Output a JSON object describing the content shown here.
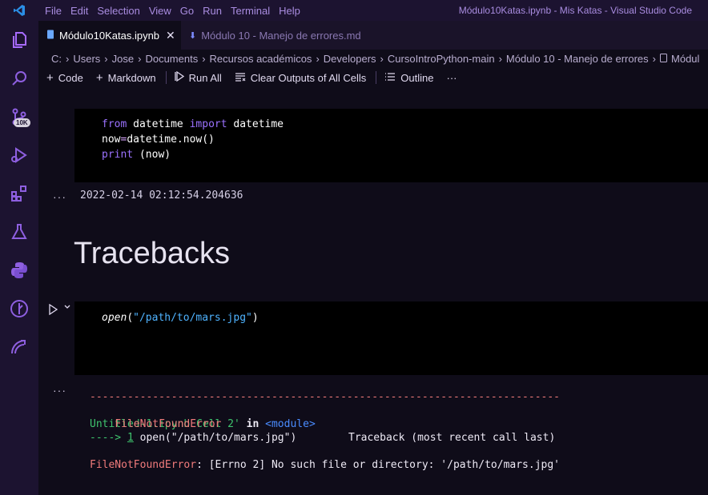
{
  "titlebar": {
    "menu": [
      "File",
      "Edit",
      "Selection",
      "View",
      "Go",
      "Run",
      "Terminal",
      "Help"
    ],
    "window_title": "Módulo10Katas.ipynb - Mis Katas - Visual Studio Code"
  },
  "activity_bar": {
    "badge": "10K"
  },
  "tabs": [
    {
      "label": "Módulo10Katas.ipynb",
      "active": true
    },
    {
      "label": "Módulo 10 - Manejo de errores.md",
      "active": false
    }
  ],
  "breadcrumb": [
    "C:",
    "Users",
    "Jose",
    "Documents",
    "Recursos académicos",
    "Developers",
    "CursoIntroPython-main",
    "Módulo 10 - Manejo de errores",
    "Módul"
  ],
  "toolbar": {
    "code": "Code",
    "markdown": "Markdown",
    "run_all": "Run All",
    "clear": "Clear Outputs of All Cells",
    "outline": "Outline",
    "more": "···"
  },
  "cell1": {
    "line1": {
      "kw1": "from",
      "mod": " datetime ",
      "kw2": "import",
      "name": " datetime"
    },
    "line2": {
      "a": "now",
      "eq": "=",
      "b": "datetime.now()"
    },
    "line3": {
      "kw": "print",
      "rest": " (now)"
    },
    "output": "2022-02-14 02:12:54.204636"
  },
  "heading": "Tracebacks",
  "cell2": {
    "fn": "open",
    "open_paren": "(",
    "arg": "\"/path/to/mars.jpg\"",
    "close_paren": ")"
  },
  "traceback": {
    "dashes": "---------------------------------------------------------------------------",
    "error_name": "FileNotFoundError",
    "header_right": "Traceback (most recent call last)",
    "cell_ref": "Untitled-1.ipynb Cell 2'",
    "in": " in ",
    "module": "<module>",
    "arrow": "----> ",
    "line_no": "1",
    "code": " open(\"/path/to/mars.jpg\")",
    "error_label": "FileNotFoundError",
    "error_msg": ": [Errno 2] No such file or directory: '/path/to/mars.jpg'"
  },
  "dots": "···"
}
